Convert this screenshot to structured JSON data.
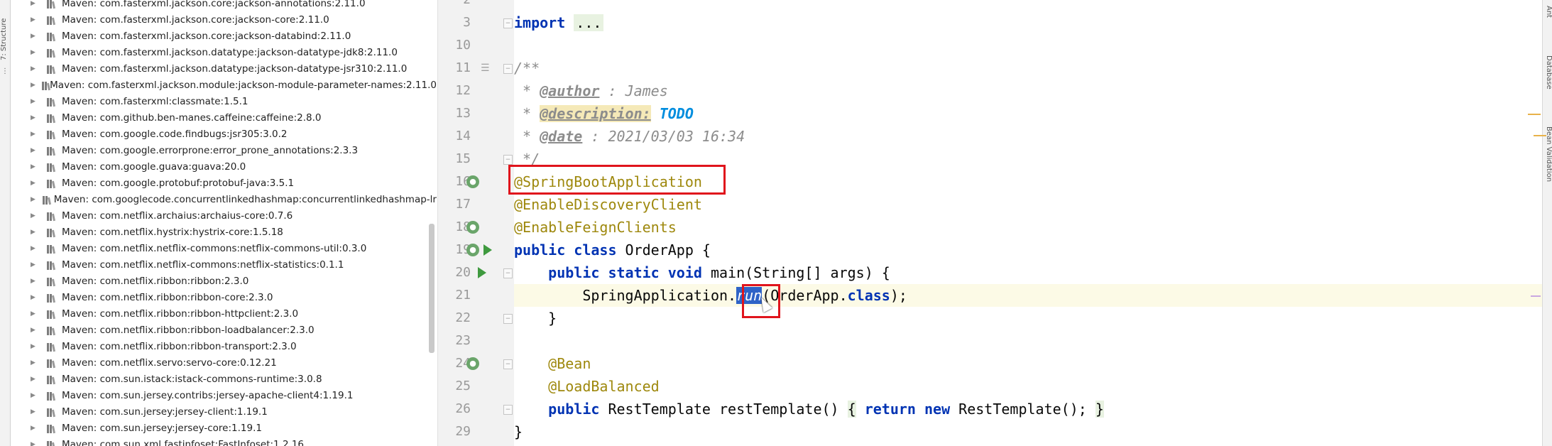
{
  "left_strip": {
    "tab": "7: Structure"
  },
  "tree": {
    "items": [
      "Maven: com.fasterxml.jackson.core:jackson-annotations:2.11.0",
      "Maven: com.fasterxml.jackson.core:jackson-core:2.11.0",
      "Maven: com.fasterxml.jackson.core:jackson-databind:2.11.0",
      "Maven: com.fasterxml.jackson.datatype:jackson-datatype-jdk8:2.11.0",
      "Maven: com.fasterxml.jackson.datatype:jackson-datatype-jsr310:2.11.0",
      "Maven: com.fasterxml.jackson.module:jackson-module-parameter-names:2.11.0",
      "Maven: com.fasterxml:classmate:1.5.1",
      "Maven: com.github.ben-manes.caffeine:caffeine:2.8.0",
      "Maven: com.google.code.findbugs:jsr305:3.0.2",
      "Maven: com.google.errorprone:error_prone_annotations:2.3.3",
      "Maven: com.google.guava:guava:20.0",
      "Maven: com.google.protobuf:protobuf-java:3.5.1",
      "Maven: com.googlecode.concurrentlinkedhashmap:concurrentlinkedhashmap-lr",
      "Maven: com.netflix.archaius:archaius-core:0.7.6",
      "Maven: com.netflix.hystrix:hystrix-core:1.5.18",
      "Maven: com.netflix.netflix-commons:netflix-commons-util:0.3.0",
      "Maven: com.netflix.netflix-commons:netflix-statistics:0.1.1",
      "Maven: com.netflix.ribbon:ribbon:2.3.0",
      "Maven: com.netflix.ribbon:ribbon-core:2.3.0",
      "Maven: com.netflix.ribbon:ribbon-httpclient:2.3.0",
      "Maven: com.netflix.ribbon:ribbon-loadbalancer:2.3.0",
      "Maven: com.netflix.ribbon:ribbon-transport:2.3.0",
      "Maven: com.netflix.servo:servo-core:0.12.21",
      "Maven: com.sun.istack:istack-commons-runtime:3.0.8",
      "Maven: com.sun.jersey.contribs:jersey-apache-client4:1.19.1",
      "Maven: com.sun.jersey:jersey-client:1.19.1",
      "Maven: com.sun.jersey:jersey-core:1.19.1",
      "Maven: com.sun.xml.fastinfoset:FastInfoset:1.2.16"
    ]
  },
  "editor": {
    "lines": [
      {
        "num": "2",
        "icons": []
      },
      {
        "num": "3",
        "icons": [
          "fold"
        ]
      },
      {
        "num": "10",
        "icons": []
      },
      {
        "num": "11",
        "icons": [
          "list",
          "fold"
        ]
      },
      {
        "num": "12",
        "icons": []
      },
      {
        "num": "13",
        "icons": []
      },
      {
        "num": "14",
        "icons": []
      },
      {
        "num": "15",
        "icons": [
          "fold"
        ]
      },
      {
        "num": "16",
        "icons": [
          "bean"
        ]
      },
      {
        "num": "17",
        "icons": []
      },
      {
        "num": "18",
        "icons": [
          "bean"
        ]
      },
      {
        "num": "19",
        "icons": [
          "bean",
          "run"
        ]
      },
      {
        "num": "20",
        "icons": [
          "run",
          "fold"
        ]
      },
      {
        "num": "21",
        "icons": []
      },
      {
        "num": "22",
        "icons": [
          "fold"
        ]
      },
      {
        "num": "23",
        "icons": []
      },
      {
        "num": "24",
        "icons": [
          "bean",
          "fold"
        ]
      },
      {
        "num": "25",
        "icons": []
      },
      {
        "num": "26",
        "icons": [
          "fold"
        ]
      },
      {
        "num": "29",
        "icons": []
      }
    ],
    "code": {
      "l3_kw": "import",
      "l3_fold": "...",
      "l11": "/**",
      "l12_star": " * ",
      "l12_tag": "@author",
      "l12_rest": " : James",
      "l13_star": " * ",
      "l13_tag": "@description:",
      "l13_todo": "TODO",
      "l14_star": " * ",
      "l14_tag": "@date",
      "l14_rest": " : 2021/03/03 16:34",
      "l15": " */",
      "l16": "@SpringBootApplication",
      "l17": "@EnableDiscoveryClient",
      "l18": "@EnableFeignClients",
      "l19_kw1": "public",
      "l19_kw2": "class",
      "l19_rest": " OrderApp {",
      "l20_kw1": "public",
      "l20_kw2": "static",
      "l20_kw3": "void",
      "l20_rest": " main(String[] args) {",
      "l21_pre": "SpringApplication.",
      "l21_sel": "run",
      "l21_mid": "(OrderApp.",
      "l21_kw": "class",
      "l21_end": ");",
      "l22": "}",
      "l24": "@Bean",
      "l25": "@LoadBalanced",
      "l26_kw": "public",
      "l26_mid": " RestTemplate restTemplate() ",
      "l26_open": "{",
      "l26_kw2": "return",
      "l26_kw3": "new",
      "l26_rest": " RestTemplate(); ",
      "l26_close": "}",
      "l29": "}"
    }
  },
  "right_strip": {
    "tabs": [
      "Ant",
      "Database",
      "Bean Validation"
    ]
  },
  "colors": {
    "keyword": "#0033b3",
    "annotation": "#9e880d",
    "comment": "#8c8c8c",
    "todo": "#008dde",
    "selection": "#2f63c7",
    "highlight_box": "#e0141c",
    "current_line": "#fcfae6"
  }
}
